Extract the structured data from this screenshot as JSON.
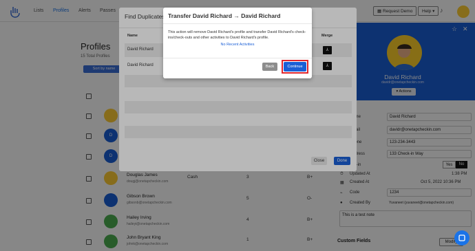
{
  "nav": {
    "items": [
      "Lists",
      "Profiles",
      "Alerts",
      "Passes"
    ]
  },
  "topbar": {
    "request_demo": "Request Demo",
    "help": "Help"
  },
  "profiles": {
    "title": "Profiles",
    "count": "15 Total Profiles",
    "sort_label": "Sort by name",
    "rows": [
      {
        "avatar_letter": "",
        "name": "",
        "email": "",
        "group": "",
        "count": "",
        "grade": ""
      },
      {
        "avatar_letter": "D",
        "name": "",
        "email": "",
        "group": "",
        "count": "",
        "grade": ""
      },
      {
        "avatar_letter": "D",
        "name": "",
        "email": "",
        "group": "",
        "count": "",
        "grade": ""
      },
      {
        "avatar_letter": "",
        "name": "Douglas James",
        "email": "dougj@onetapcheckin.com",
        "group": "Cash",
        "count": "3",
        "grade": "B+"
      },
      {
        "avatar_letter": "",
        "name": "Gibson Brown",
        "email": "gibsonb@onetapcheckin.com",
        "group": "",
        "count": "5",
        "grade": "O-"
      },
      {
        "avatar_letter": "",
        "name": "Hailey Irving",
        "email": "haileyi@onetapcheckin.com",
        "group": "",
        "count": "4",
        "grade": "B+"
      },
      {
        "avatar_letter": "",
        "name": "John Bryant King",
        "email": "johnk@onetapcheckin.com",
        "group": "",
        "count": "1",
        "grade": "B+"
      }
    ]
  },
  "right_panel": {
    "name": "David Richard",
    "email": "davidr@onetapcheckin.com",
    "actions": "Actions",
    "fields": {
      "name_label": "Name",
      "name_value": "David Richard",
      "email_label": "Email",
      "email_value": "davidr@onetapcheckin.com",
      "phone_label": "Phone",
      "phone_value": "123-234-3443",
      "address_label": "Address",
      "address_value": "133 Check-in Way",
      "sms_label": "Opt-in",
      "yes": "Yes",
      "no": "No",
      "updated_label": "Updated At",
      "updated_value": "1:38 PM",
      "created_label": "Created At",
      "created_value": "Oct 5, 2022 10:36 PM",
      "code_label": "Code",
      "code_value": "1234",
      "created_by_label": "Created By",
      "created_by_value": "Yuvaneet (yuvaneet@onetapcheckin.com)"
    },
    "note": "This is a test note",
    "custom_fields": "Custom Fields",
    "modify": "Modify"
  },
  "dup_modal": {
    "title": "Find Duplicates",
    "col_name": "Name",
    "col_merge": "Merge",
    "rows": [
      {
        "name": "David Richard",
        "merge": "⅄"
      },
      {
        "name": "David Richard",
        "merge": "⅄"
      }
    ],
    "close": "Close",
    "done": "Done"
  },
  "transfer_modal": {
    "title": "Transfer David Richard → David Richard",
    "message": "This action will remove David Richard's profile and transfer David Richard's check-ins/check-outs and other activities to David Richard's profile.",
    "link": "No Recent Activities",
    "back": "Back",
    "continue": "Continue"
  },
  "colors": {
    "primary": "#1a5fd6",
    "highlight": "#e0252b",
    "merge": "#111111"
  }
}
